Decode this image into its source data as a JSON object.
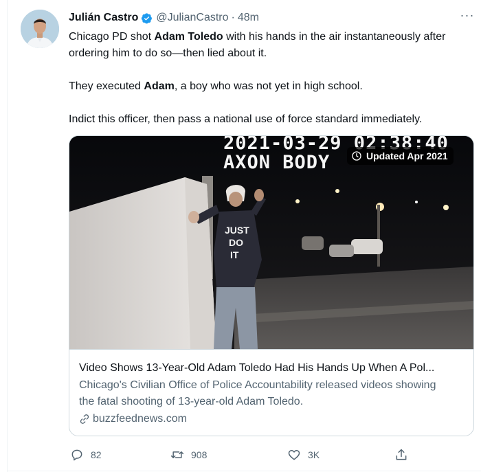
{
  "tweet": {
    "author": {
      "display_name": "Julián Castro",
      "handle": "@JulianCastro",
      "separator": "·",
      "time": "48m"
    },
    "more_label": "···",
    "text": {
      "p1_a": "Chicago PD shot ",
      "p1_bold": "Adam Toledo",
      "p1_b": " with his hands in the air instantaneously after ordering him to do so—then lied about it.",
      "p2_a": "They executed ",
      "p2_bold": "Adam",
      "p2_b": ", a boy who was not yet in high school.",
      "p3": "Indict this officer, then pass a national use of force standard immediately."
    },
    "card": {
      "bodycam_timestamp": "2021-03-29 02:38:40",
      "bodycam_label": "AXON BODY",
      "updated_badge": "Updated Apr 2021",
      "title": "Video Shows 13-Year-Old Adam Toledo Had His Hands Up When A Pol...",
      "description": "Chicago's Civilian Office of Police Accountability released videos showing the fatal shooting of 13-year-old Adam Toledo.",
      "domain": "buzzfeednews.com"
    },
    "actions": {
      "replies": "82",
      "retweets": "908",
      "likes": "3K"
    },
    "colors": {
      "verified_blue": "#1d9bf0",
      "text": "#0f1419",
      "secondary": "#536471",
      "border": "#cfd9de"
    }
  }
}
